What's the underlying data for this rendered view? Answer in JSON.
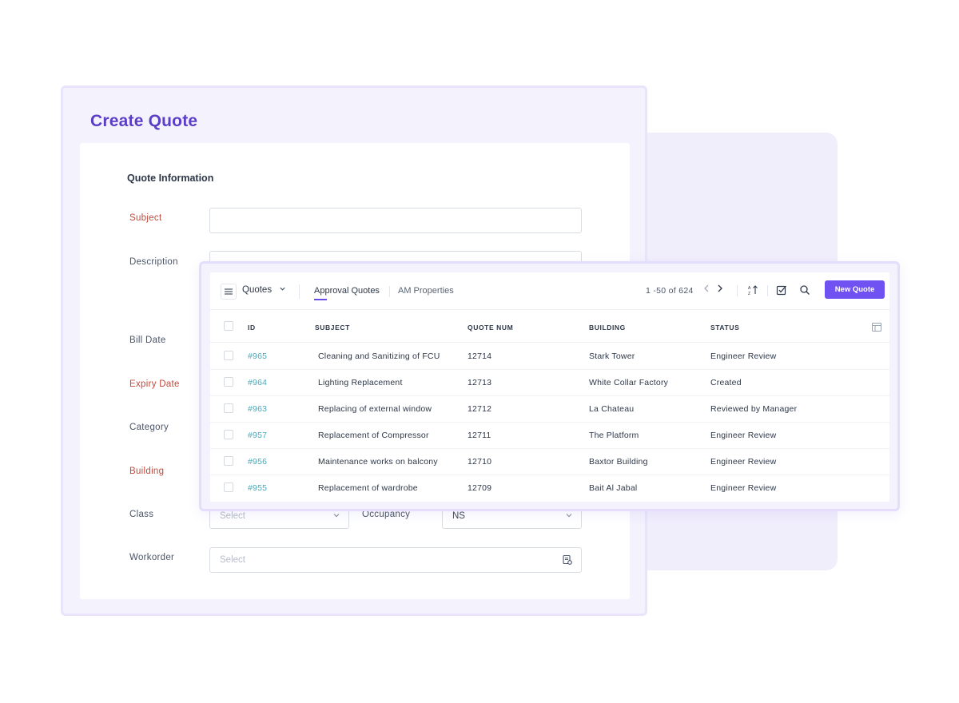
{
  "create_quote": {
    "title": "Create Quote",
    "section_title": "Quote Information",
    "labels": {
      "subject": "Subject",
      "description": "Description",
      "bill_date": "Bill Date",
      "expiry_date": "Expiry Date",
      "category": "Category",
      "building": "Building",
      "class": "Class",
      "occupancy": "Occupancy",
      "workorder": "Workorder"
    },
    "class_placeholder": "Select",
    "occupancy_value": "NS",
    "workorder_placeholder": "Select",
    "colors": {
      "title": "#5b3ec8",
      "required_label": "#c0493d"
    }
  },
  "quotes_list": {
    "view_name": "Quotes",
    "tabs": [
      {
        "label": "Approval Quotes",
        "active": true
      },
      {
        "label": "AM Properties",
        "active": false
      }
    ],
    "pagination": "1 -50 of 624",
    "new_button": "New Quote",
    "columns": [
      "ID",
      "SUBJECT",
      "QUOTE NUM",
      "BUILDING",
      "STATUS"
    ],
    "rows": [
      {
        "id": "#965",
        "subject": "Cleaning and Sanitizing of FCU",
        "quote_num": "12714",
        "building": "Stark Tower",
        "status": "Engineer Review"
      },
      {
        "id": "#964",
        "subject": "Lighting Replacement",
        "quote_num": "12713",
        "building": "White Collar Factory",
        "status": "Created"
      },
      {
        "id": "#963",
        "subject": "Replacing of external window",
        "quote_num": "12712",
        "building": "La Chateau",
        "status": "Reviewed by Manager"
      },
      {
        "id": "#957",
        "subject": "Replacement of Compressor",
        "quote_num": "12711",
        "building": "The Platform",
        "status": "Engineer Review"
      },
      {
        "id": "#956",
        "subject": "Maintenance works on balcony",
        "quote_num": "12710",
        "building": "Baxtor Building",
        "status": "Engineer Review"
      },
      {
        "id": "#955",
        "subject": "Replacement of wardrobe",
        "quote_num": "12709",
        "building": "Bait Al Jabal",
        "status": "Engineer Review"
      }
    ],
    "icons": [
      "menu-icon",
      "chevron-down-icon",
      "chevron-left-icon",
      "chevron-right-icon",
      "sort-icon",
      "bulk-edit-icon",
      "search-icon",
      "column-settings-icon"
    ],
    "colors": {
      "primary": "#7052f2",
      "id_link": "#4aa8b8"
    }
  }
}
